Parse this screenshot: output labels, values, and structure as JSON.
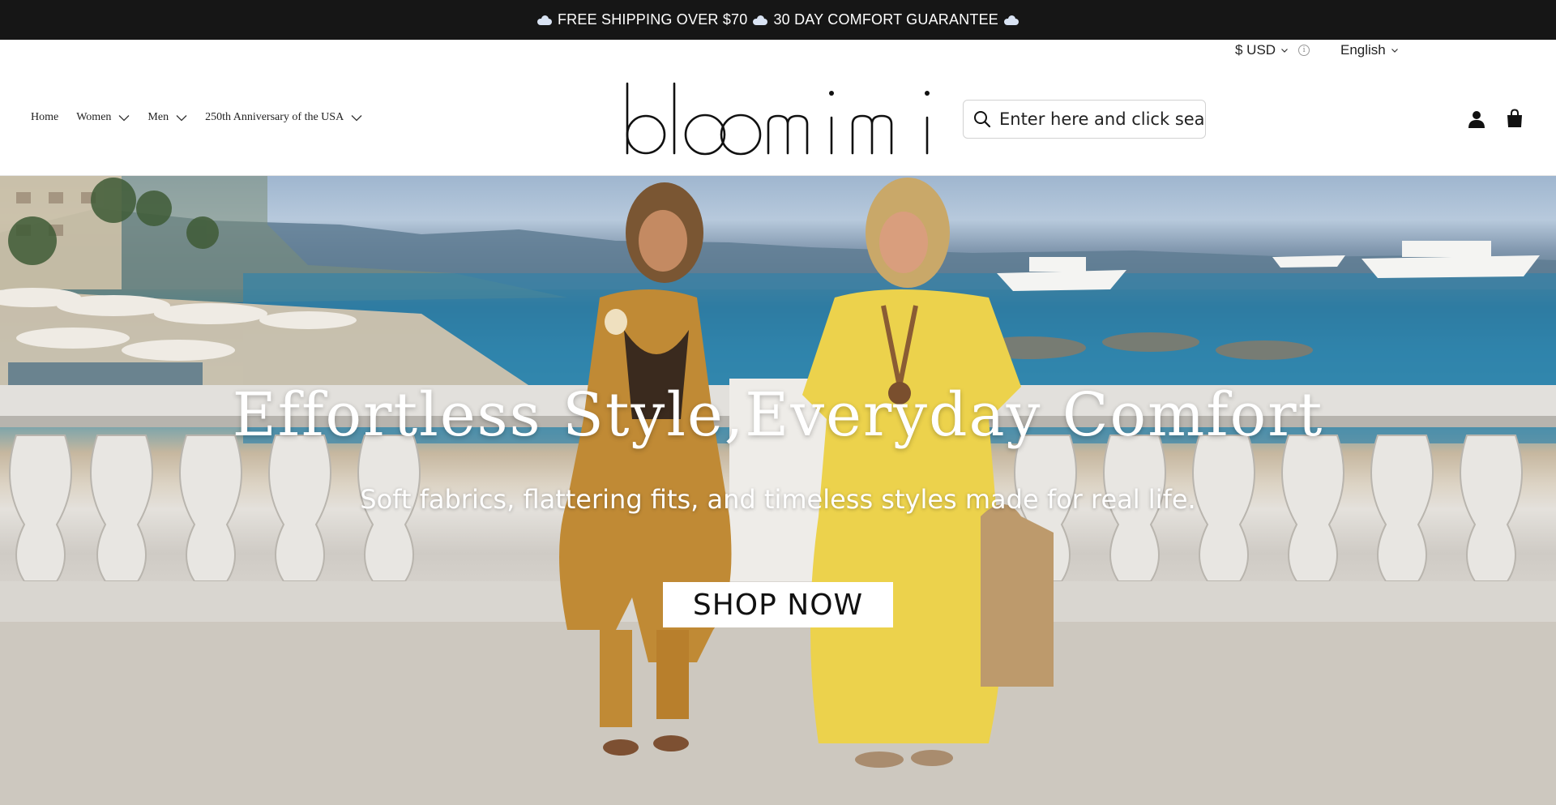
{
  "announcement": {
    "part1": "FREE SHIPPING OVER $70",
    "part2": "30 DAY COMFORT GUARANTEE",
    "icon": "cloud-icon"
  },
  "utility": {
    "currency": "$ USD",
    "info_icon": "i",
    "language": "English"
  },
  "header": {
    "logo_alt": "bloomimi",
    "nav": [
      {
        "label": "Home",
        "has_dropdown": false
      },
      {
        "label": "Women",
        "has_dropdown": true
      },
      {
        "label": "Men",
        "has_dropdown": true
      },
      {
        "label": "250th Anniversary of the USA",
        "has_dropdown": true
      }
    ],
    "search_placeholder": "Enter here and click search",
    "icons": [
      "search-icon",
      "account-icon",
      "cart-icon"
    ]
  },
  "hero": {
    "title": "Effortless Style,Everyday Comfort",
    "subtitle": "Soft fabrics, flattering fits, and timeless styles made for real life.",
    "cta": "SHOP NOW"
  },
  "colors": {
    "announcement_bg": "#161616",
    "text": "#111111",
    "cta_bg": "#ffffff"
  }
}
